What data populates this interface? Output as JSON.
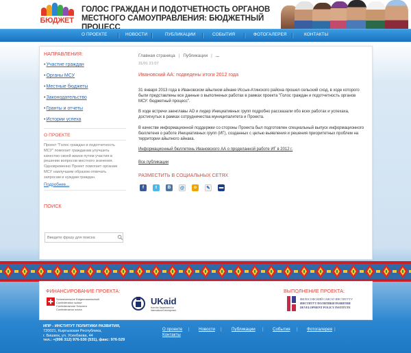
{
  "logo": {
    "text": "БЮДЖЕТ"
  },
  "header": {
    "title_line1": "ГОЛОС ГРАЖДАН И ПОДОТЧЕТНОСТЬ ОРГАНОВ",
    "title_line2": "МЕСТНОГО САМОУПРАВЛЕНИЯ: БЮДЖЕТНЫЙ ПРОЦЕСС"
  },
  "nav": {
    "items": [
      "О ПРОЕКТЕ",
      "НОВОСТИ",
      "ПУБЛИКАЦИИ",
      "СОБЫТИЯ",
      "ФОТОГАЛЕРЕЯ",
      "КОНТАКТЫ"
    ]
  },
  "sidebar": {
    "heading": "НАПРАВЛЕНИЯ:",
    "items": [
      "Участие граждан",
      "Органы МСУ",
      "Местные бюджеты",
      "Законодательство",
      "Гранты и отчеты",
      "Истории успеха"
    ],
    "about_heading": "О ПРОЕКТЕ",
    "about_text": "Проект \"Голос граждан и подотчетность МСУ\" помогает гражданам улучшить качество своей жизни путем участия в решении вопросов местного значения. Одновременно Проект помогает органам МСУ наилучшим образом отвечать запросам и нуждам граждан.",
    "more": "Подробнее...",
    "search_heading": "ПОИСК",
    "search_placeholder": "Введите фразу для поиска"
  },
  "content": {
    "breadcrumbs": [
      "Главная страница",
      "Публикации",
      "..."
    ],
    "date": "31/01 21:07",
    "title": "Ивановский АА: подведены итоги 2012 года",
    "para1": "31 января 2013 года в Ивановском айылном айнаке Иссык-Атинского района прошел сельский сход, в ходе которого были представлены все данные о выполненых работах в рамках проекта \"Голос граждан и подотчетность органов МСУ: бюджетный процесс\".",
    "para2": "В ходе встречи заенглавы АО и лидер Инициативных групп подробно рассказали обо всех работах и успехаха, достигнутых в рамках сотрудничества муниципалитета и Проекта.",
    "para3": "В качестве информационной поддержки со стороны Проекта был подготовлен специальный выпуск информационного бюллетеня о работе Инициативных групп (ИГ), созданных с целью выявления и решения приоритетных проблем на территории айылного айнака.",
    "doc_link": "Информационный бюллетень Ивановского АА о проделанной работе ИГ в 2012 г.",
    "all_link": "Все публикации",
    "share_heading": "РАЗМЕСТИТЬ В СОЦИАЛЬНЫХ СЕТЯХ",
    "share_icons": [
      "facebook-icon",
      "twitter-icon",
      "vkontakte-icon",
      "mail-ru-icon",
      "odnoklassniki-icon",
      "livejournal-icon",
      "myspace-icon"
    ]
  },
  "funding": {
    "heading": "ФИНАНСИРОВАНИЕ ПРОЕКТА:",
    "swiss_lines": [
      "Schweizerische Eidgenossenschaft",
      "Confédération suisse",
      "Confederazione Svizzera",
      "Confederaziun svizra"
    ],
    "ukaid_main": "UKaid",
    "ukaid_sub": "from the Department for International Development",
    "impl_heading": "ВЫПОЛНЕНИЕ ПРОЕКТА:",
    "dpi_lines": [
      "ФИЛОСОФСКИЙ САЯСАТ ИНСТИТУТУ",
      "ИНСТИТУТ ПОЛИТИКИ РАЗВИТИЯ",
      "DEVELOPMENT POLICY INSTITUTE"
    ]
  },
  "footer": {
    "org": "ИПР - ИНСТИТУТ ПОЛИТИКИ РАЗВИТИЯ,",
    "addr1": "720021, Кыргызская Республика,",
    "addr2": "г. Бишкек, ул. Усенбаева, 44",
    "phone": "тел.: +(996 312) 976-530 (531), факс: 976-529",
    "links": [
      "О проекте",
      "Новости",
      "Публикации",
      "События",
      "Фотогалерея",
      "Контакты"
    ]
  },
  "colors": {
    "nav_blue": "#2a86d0",
    "heading_red": "#d8453a",
    "link_blue": "#2a66b3"
  }
}
